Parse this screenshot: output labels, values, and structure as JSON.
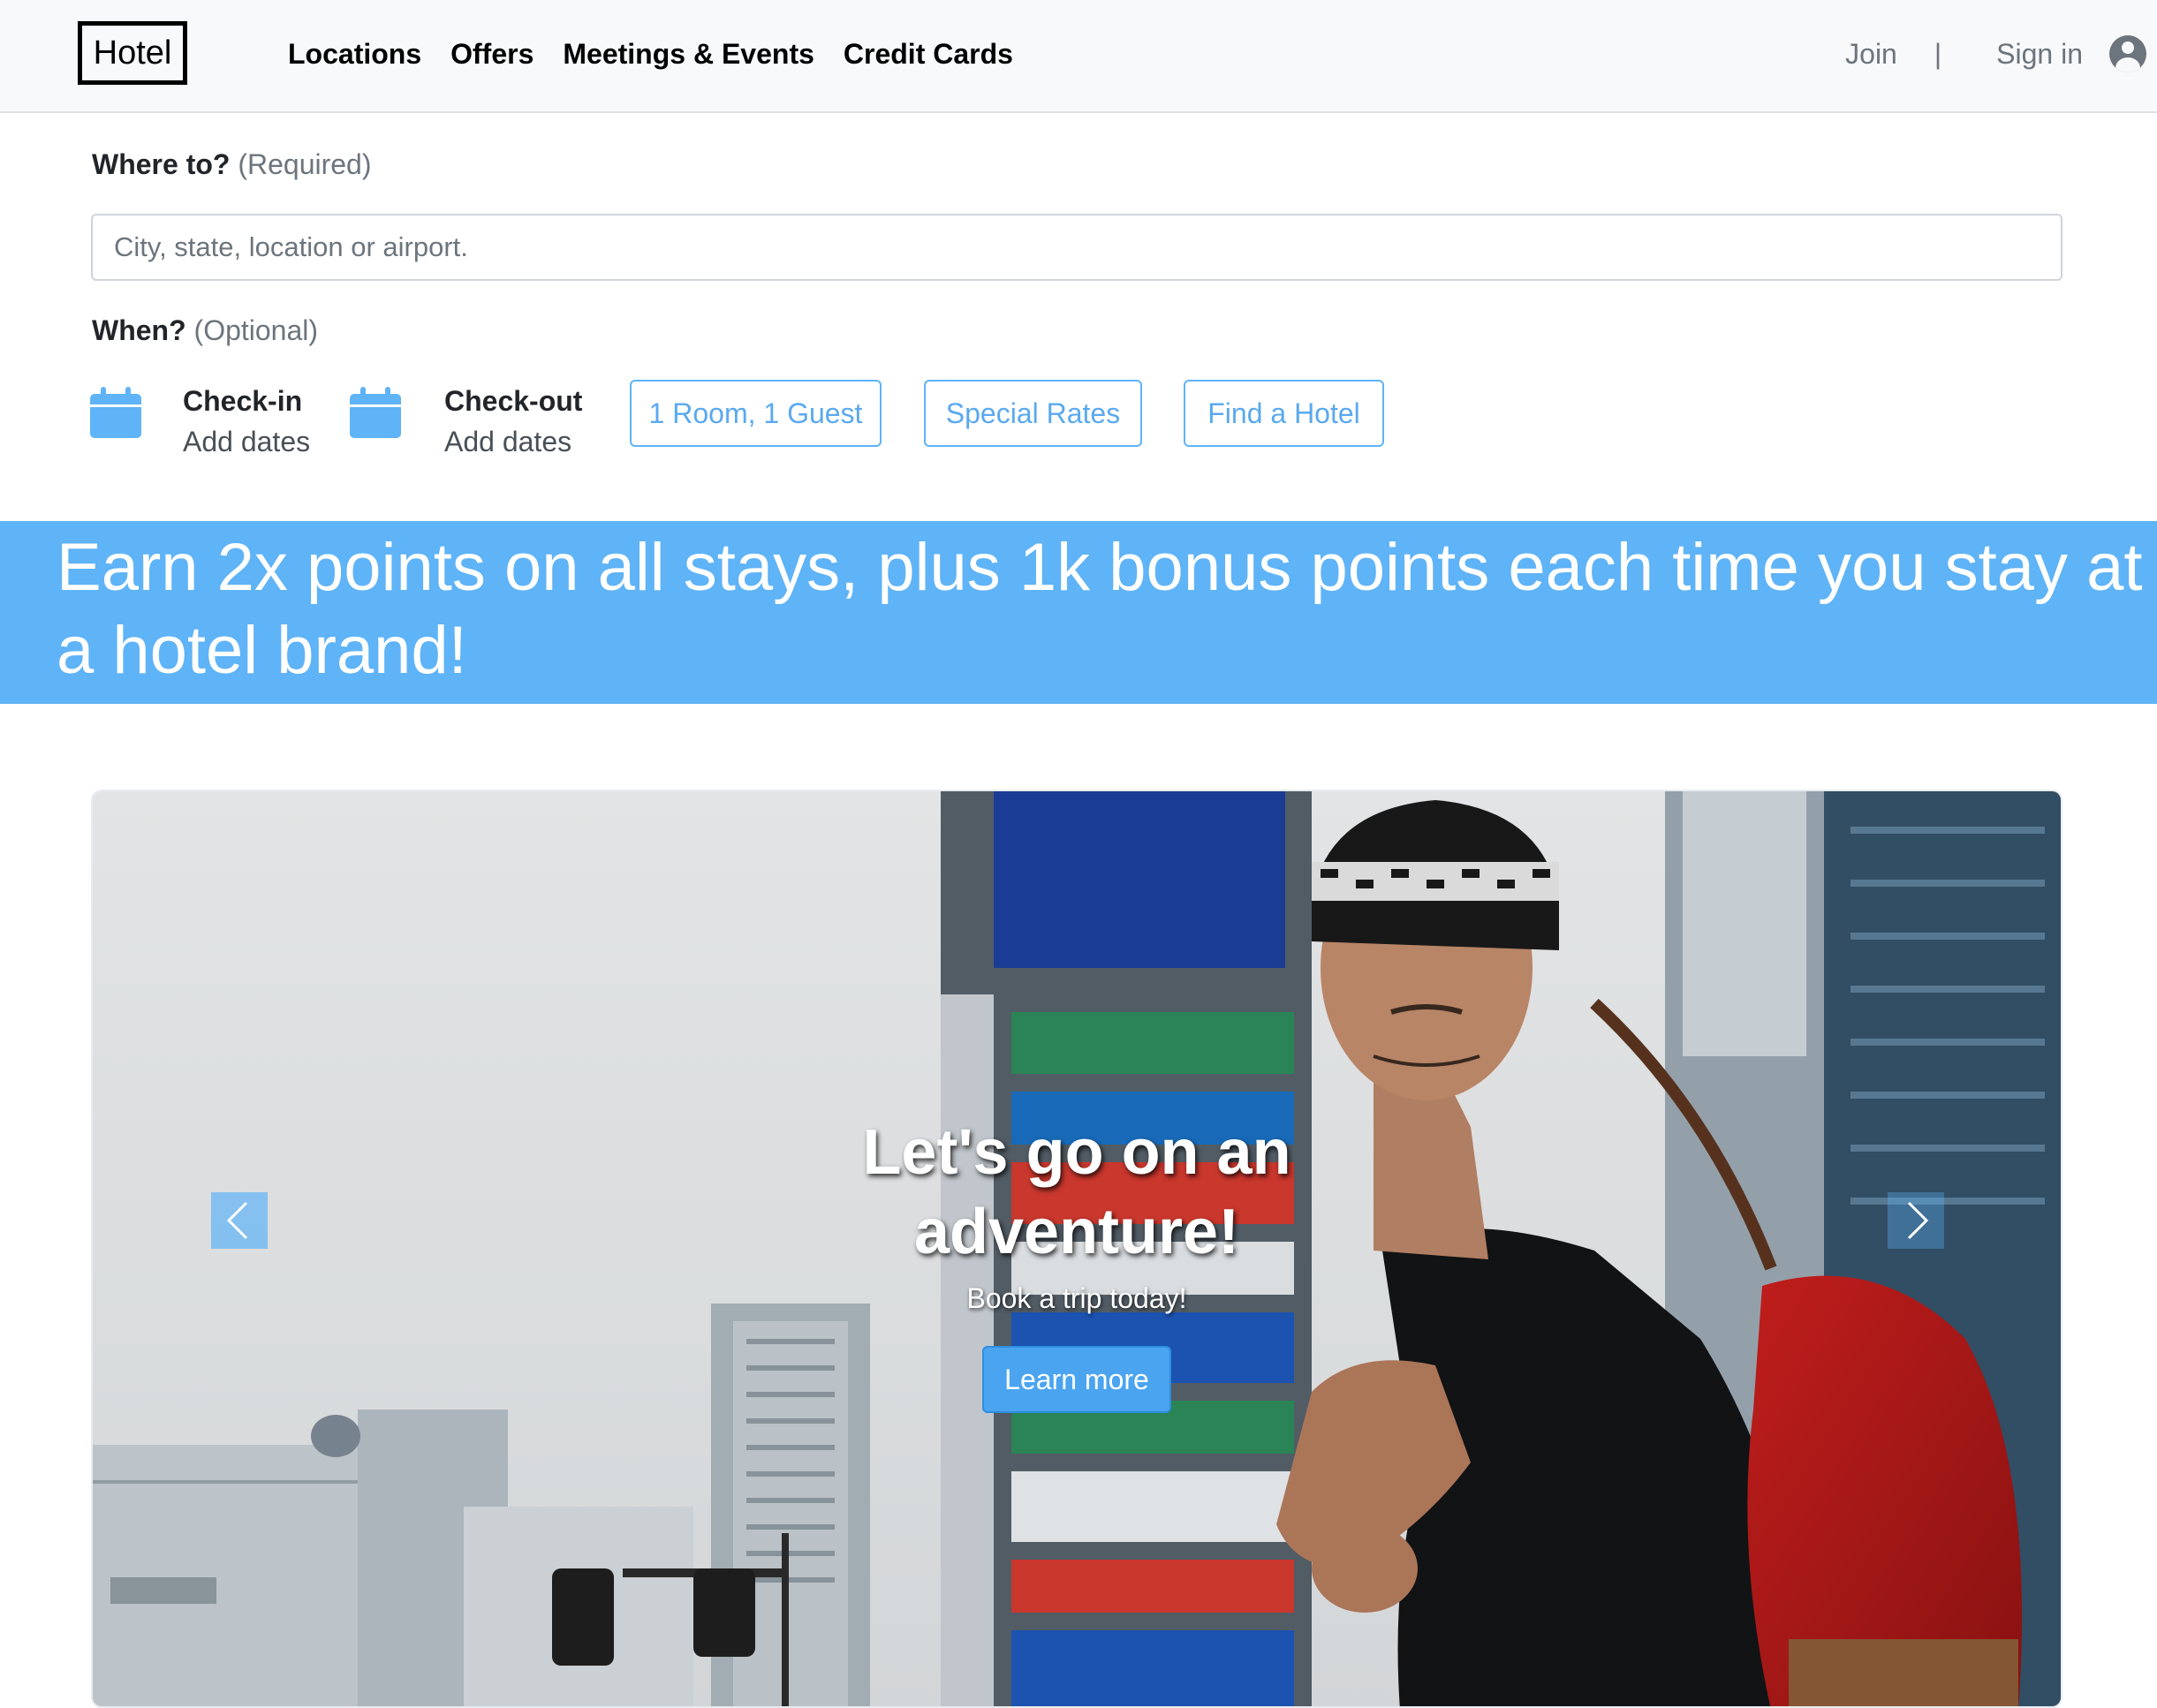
{
  "navbar": {
    "brand": "Hotel",
    "links": [
      "Locations",
      "Offers",
      "Meetings & Events",
      "Credit Cards"
    ],
    "join": "Join",
    "separator": "|",
    "sign_in": "Sign in",
    "user_icon": "user-circle-icon"
  },
  "search": {
    "where_label": "Where to?",
    "where_hint": "(Required)",
    "placeholder": "City, state, location or airport.",
    "when_label": "When?",
    "when_hint": "(Optional)",
    "checkin_title": "Check-in",
    "checkin_value": "Add dates",
    "checkout_title": "Check-out",
    "checkout_value": "Add dates",
    "calendar_icon": "calendar-icon",
    "rooms_button": "1 Room, 1 Guest",
    "rates_button": "Special Rates",
    "find_button": "Find a Hotel"
  },
  "promo": {
    "text": "Earn 2x points on all stays, plus 1k bonus points each time you stay at a hotel brand!"
  },
  "carousel": {
    "title": "Let's go on an adventure!",
    "subtitle": "Book a trip today!",
    "button": "Learn more",
    "prev_icon": "chevron-left-icon",
    "next_icon": "chevron-right-icon"
  },
  "colors": {
    "accent": "#5fb3f7",
    "navbar_bg": "#f8f9fa",
    "muted": "#6c757d"
  }
}
